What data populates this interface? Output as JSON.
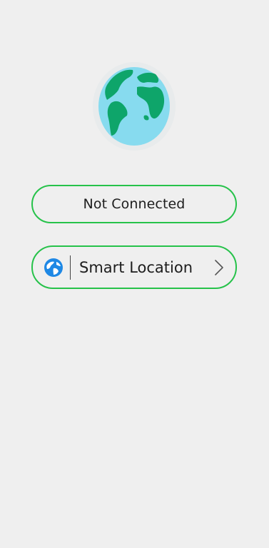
{
  "status": {
    "label": "Not Connected"
  },
  "location": {
    "label": "Smart Location"
  },
  "icons": {
    "globe": "globe-icon",
    "location": "location-globe-icon",
    "chevron": "chevron-right-icon"
  },
  "colors": {
    "background": "#efefef",
    "accent_border": "#26c24a",
    "globe_ocean": "#87dbef",
    "globe_land": "#0ea56a",
    "location_icon": "#1e88e5"
  }
}
